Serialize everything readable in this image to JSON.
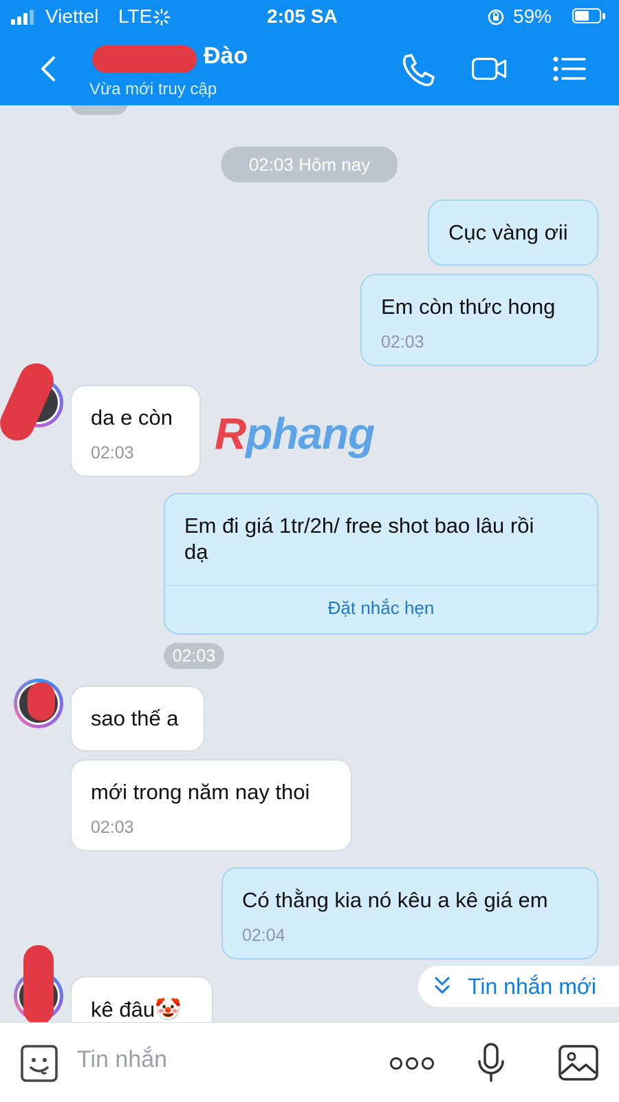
{
  "status_bar": {
    "carrier": "Viettel",
    "network": "LTE",
    "time": "2:05 SA",
    "battery": "59%"
  },
  "header": {
    "title": "Đào",
    "subtitle": "Vừa mới truy cập"
  },
  "chat": {
    "date_separator": "02:03 Hôm nay",
    "messages": [
      {
        "dir": "out",
        "text": "Cục vàng ơii"
      },
      {
        "dir": "out",
        "text": "Em còn thức hong",
        "time": "02:03"
      },
      {
        "dir": "in",
        "text": "da e còn",
        "time": "02:03"
      },
      {
        "dir": "out",
        "text": "Em đi giá 1tr/2h/ free shot bao lâu rồi",
        "text2": "dạ",
        "action": "Đặt nhắc hẹn",
        "time": "02:03"
      },
      {
        "dir": "in",
        "text": "sao thế a"
      },
      {
        "dir": "in",
        "text": "mới trong năm nay thoi",
        "time": "02:03"
      },
      {
        "dir": "out",
        "text": "Có thằng kia nó kêu a kê giá em",
        "time": "02:04"
      },
      {
        "dir": "in",
        "text": "kê đâu",
        "emoji": "🤡"
      }
    ],
    "watermark": {
      "part1": "R",
      "part2": "phang"
    },
    "new_messages_label": "Tin nhắn mới"
  },
  "composer": {
    "placeholder": "Tin nhắn"
  },
  "icons": [
    "back-icon",
    "phone-icon",
    "video-icon",
    "menu-icon",
    "sticker-icon",
    "more-icon",
    "mic-icon",
    "image-icon",
    "chevron-down-icon"
  ],
  "colors": {
    "accent": "#0e8ef3",
    "outgoing_bubble": "#d3edfb",
    "incoming_bubble": "#ffffff",
    "background": "#e2e7ee"
  }
}
